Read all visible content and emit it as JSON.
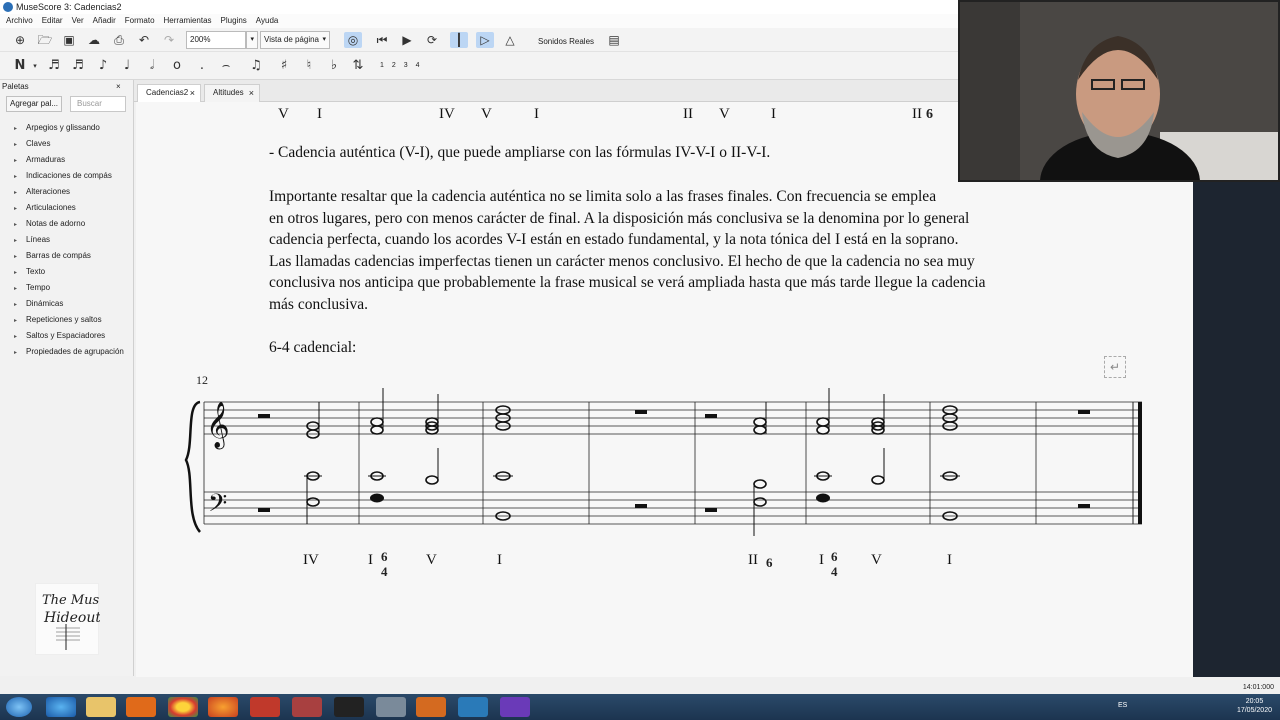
{
  "window": {
    "title": "MuseScore 3: Cadencias2"
  },
  "menu": [
    "Archivo",
    "Editar",
    "Ver",
    "Añadir",
    "Formato",
    "Herramientas",
    "Plugins",
    "Ayuda"
  ],
  "toolbar": {
    "zoom_value": "200%",
    "view_mode": "Vista de página",
    "sounds_label": "Sonidos Reales"
  },
  "note_toolbar": {
    "voices": [
      "1",
      "2",
      "3",
      "4"
    ]
  },
  "palettes": {
    "title": "Paletas",
    "add_button": "Agregar pal...",
    "search_placeholder": "Buscar",
    "items": [
      "Arpegios y glissando",
      "Claves",
      "Armaduras",
      "Indicaciones de compás",
      "Alteraciones",
      "Articulaciones",
      "Notas de adorno",
      "Líneas",
      "Barras de compás",
      "Texto",
      "Tempo",
      "Dinámicas",
      "Repeticiones y saltos",
      "Saltos y Espaciadores",
      "Propiedades de agrupación"
    ]
  },
  "logo": {
    "text": "The Music Hideout"
  },
  "tabs": [
    {
      "label": "Cadencias2"
    },
    {
      "label": "Altitudes"
    }
  ],
  "score": {
    "top_numerals": [
      "V",
      "I",
      "IV",
      "V",
      "I",
      "II",
      "V",
      "I",
      "II"
    ],
    "top_figure": "6",
    "line1": "- Cadencia auténtica (V-I), que puede ampliarse con las fórmulas IV-V-I o II-V-I.",
    "paragraph": [
      "Importante resaltar que la cadencia auténtica no se limita solo a las frases finales. Con frecuencia se emplea",
      "en otros lugares, pero con menos carácter de final. A la disposición más conclusiva se la denomina por lo general",
      "cadencia perfecta, cuando los acordes V-I están en estado fundamental, y la nota tónica del I está en la soprano.",
      "Las llamadas cadencias imperfectas tienen un carácter menos conclusivo. El hecho de que la cadencia no sea muy",
      "conclusiva nos anticipa que probablemente la frase musical se verá ampliada hasta que más tarde llegue la cadencia",
      "más conclusiva."
    ],
    "heading": "6-4 cadencial:",
    "measure_number": "12",
    "bottom_numerals": [
      "IV",
      "I",
      "V",
      "I",
      "II",
      "I",
      "V",
      "I"
    ],
    "figure_upper": "6",
    "figure_lower": "4"
  },
  "status": {
    "time": "14:01:000"
  },
  "system_tray": {
    "lang": "ES",
    "clock_time": "20:05",
    "clock_date": "17/05/2020"
  }
}
